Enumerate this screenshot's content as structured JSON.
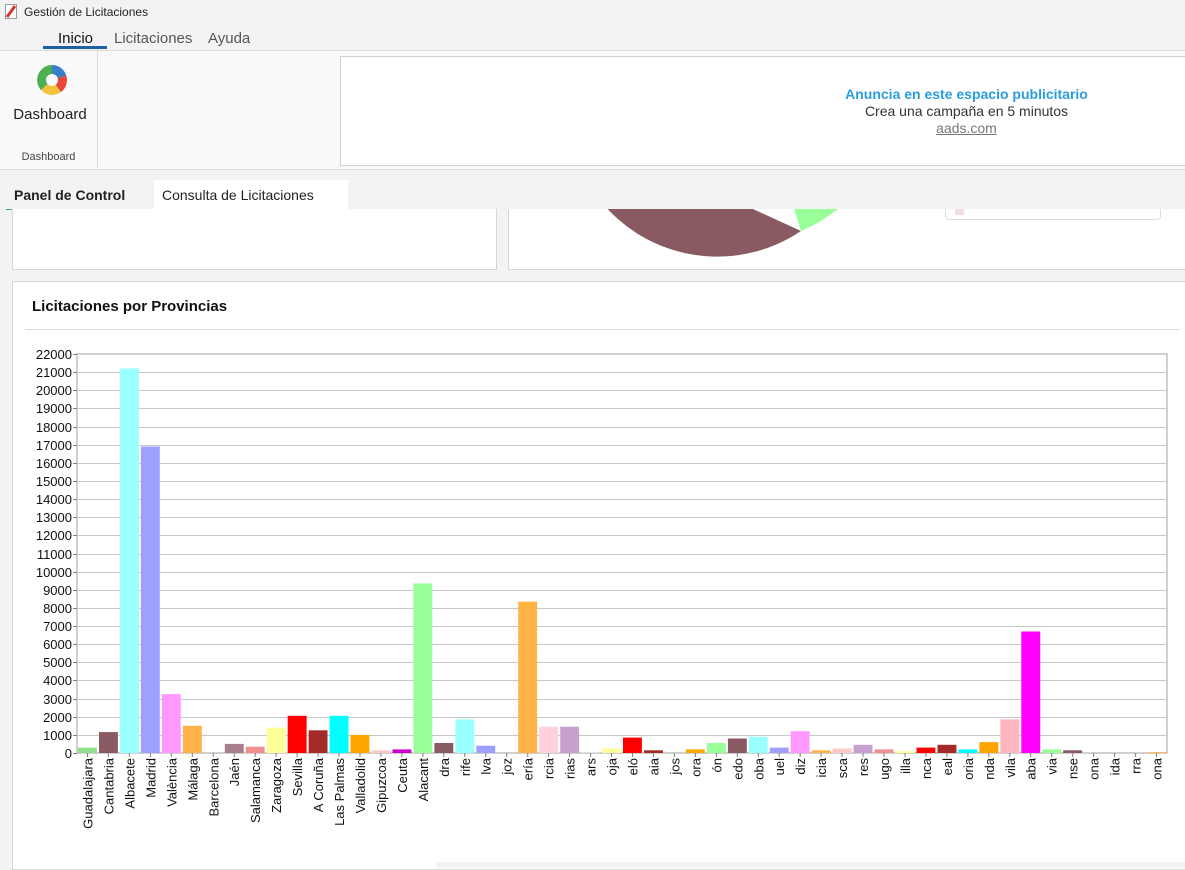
{
  "window": {
    "title": "Gestión de Licitaciones"
  },
  "menu": {
    "items": [
      "Inicio",
      "Licitaciones",
      "Ayuda"
    ],
    "active": "Inicio"
  },
  "ribbon": {
    "button_label": "Dashboard",
    "group_label": "Dashboard"
  },
  "ad": {
    "title": "Anuncia en este espacio publicitario",
    "subtitle": "Crea una campaña en 5 minutos",
    "link": "aads.com"
  },
  "tabs": [
    "Panel de Control",
    "Consulta de Licitaciones"
  ],
  "colors": {
    "accent": "#2aa3a3",
    "menu_underline": "#1f5fa8",
    "ad_title": "#2a9de0"
  },
  "chart_data": {
    "type": "bar",
    "title": "Licitaciones por Provincias",
    "ylim": [
      0,
      22000
    ],
    "ytick_step": 1000,
    "grid": true,
    "categories": [
      "Guadalajara",
      "Cantabria",
      "Albacete",
      "Madrid",
      "València",
      "Málaga",
      "Barcelona",
      "Jaén",
      "Salamanca",
      "Zaragoza",
      "Sevilla",
      "A Coruña",
      "Las Palmas",
      "Valladolid",
      "Gipuzcoa",
      "Ceuta",
      "Alacant",
      "dra",
      "rife",
      "lva",
      "joz",
      "ería",
      "rcia",
      "rias",
      "ars",
      "oja",
      "eló",
      "aia",
      "jos",
      "ora",
      "ón",
      "edo",
      "oba",
      "uel",
      "diz",
      "icia",
      "sca",
      "res",
      "ugo",
      "illa",
      "nca",
      "eal",
      "oria",
      "nda",
      "vila",
      "aba",
      "via",
      "nse",
      "ona",
      "ida",
      "rra",
      "ona"
    ],
    "values": [
      300,
      1150,
      21200,
      16900,
      3250,
      1500,
      0,
      500,
      350,
      1400,
      2050,
      1250,
      2050,
      1000,
      150,
      200,
      9350,
      550,
      1850,
      400,
      0,
      8350,
      1450,
      1450,
      50,
      250,
      850,
      150,
      0,
      200,
      550,
      800,
      900,
      300,
      1200,
      150,
      250,
      450,
      200,
      100,
      300,
      450,
      200,
      600,
      1850,
      6700,
      200,
      150,
      0,
      0,
      0,
      50
    ],
    "colors": [
      "#8fe08f",
      "#8a5a62",
      "#99ffff",
      "#9f9fff",
      "#ff99ff",
      "#ffb347",
      "#dddddd",
      "#a87e8e",
      "#ee9090",
      "#ffff99",
      "#ff0000",
      "#a52a2a",
      "#00ffff",
      "#ffa500",
      "#ffc8c8",
      "#cc00cc",
      "#99ff99",
      "#8a5a62",
      "#99ffff",
      "#9f9fff",
      "#cccccc",
      "#ffb347",
      "#ffd1dc",
      "#c8a0d0",
      "#dddddd",
      "#ffff99",
      "#ff0000",
      "#a52a2a",
      "#dddddd",
      "#ffa500",
      "#99ff99",
      "#8a5a62",
      "#99ffff",
      "#9f9fff",
      "#ff99ff",
      "#ffb347",
      "#ffc8c8",
      "#c8a0d0",
      "#ee9090",
      "#ffff99",
      "#ff0000",
      "#a52a2a",
      "#00ffff",
      "#ffa500",
      "#ffb6c1",
      "#ff00ff",
      "#99ff99",
      "#8a5a62",
      "#dddddd",
      "#dddddd",
      "#dddddd",
      "#ffb347"
    ]
  }
}
